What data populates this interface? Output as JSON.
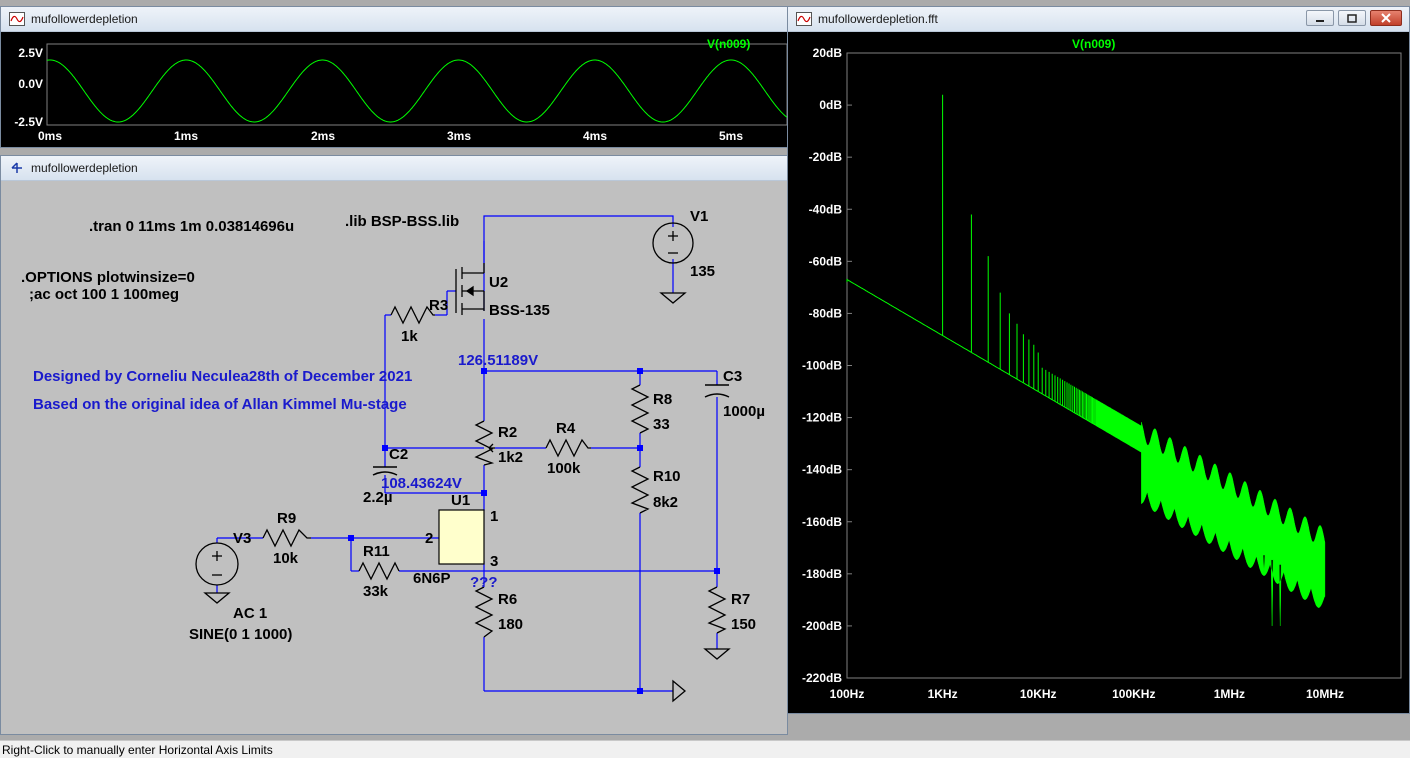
{
  "windows": {
    "wave": {
      "title": "mufollowerdepletion"
    },
    "schematic": {
      "title": "mufollowerdepletion"
    },
    "fft": {
      "title": "mufollowerdepletion.fft"
    }
  },
  "wave_plot": {
    "trace": "V(n009)",
    "y_ticks": [
      "2.5V",
      "0.0V",
      "-2.5V"
    ],
    "x_ticks": [
      "0ms",
      "1ms",
      "2ms",
      "3ms",
      "4ms",
      "5ms"
    ],
    "trace_color": "#00ff00"
  },
  "fft_plot": {
    "trace": "V(n009)",
    "y_ticks": [
      "20dB",
      "0dB",
      "-20dB",
      "-40dB",
      "-60dB",
      "-80dB",
      "-100dB",
      "-120dB",
      "-140dB",
      "-160dB",
      "-180dB",
      "-200dB",
      "-220dB"
    ],
    "x_ticks": [
      "100Hz",
      "1KHz",
      "10KHz",
      "100KHz",
      "1MHz",
      "10MHz"
    ],
    "trace_color": "#00ff00"
  },
  "schematic": {
    "directive_tran": ".tran 0 11ms 1m 0.03814696u",
    "directive_lib": ".lib BSP-BSS.lib",
    "options_line1": ".OPTIONS plotwinsize=0",
    "options_line2": ";ac oct 100 1 100meg",
    "comment1": "Designed by Corneliu Neculea28th of December 2021",
    "comment2": "Based on the original idea of Allan Kimmel Mu-stage",
    "v1_name": "V1",
    "v1_value": "135",
    "u2_name": "U2",
    "u2_model": "BSS-135",
    "r3_name": "R3",
    "r3_value": "1k",
    "node_top_voltage": "126.51189V",
    "c3_name": "C3",
    "c3_value": "1000µ",
    "r8_name": "R8",
    "r8_value": "33",
    "r2_name": "R2",
    "r2_value": "1k2",
    "r4_name": "R4",
    "r4_value": "100k",
    "r10_name": "R10",
    "r10_value": "8k2",
    "c2_name": "C2",
    "c2_value": "2.2µ",
    "node_mid_voltage": "108.43624V",
    "u1_name": "U1",
    "u1_model": "6N6P",
    "u1_pin1": "1",
    "u1_pin2": "2",
    "u1_pin3": "3",
    "unknown_voltage": "???",
    "r9_name": "R9",
    "r9_value": "10k",
    "v3_name": "V3",
    "r11_name": "R11",
    "r11_value": "33k",
    "r6_name": "R6",
    "r6_value": "180",
    "r7_name": "R7",
    "r7_value": "150",
    "v3_ac": "AC 1",
    "v3_sine": "SINE(0 1 1000)"
  },
  "status": {
    "text": "Right-Click to manually enter Horizontal Axis Limits"
  }
}
